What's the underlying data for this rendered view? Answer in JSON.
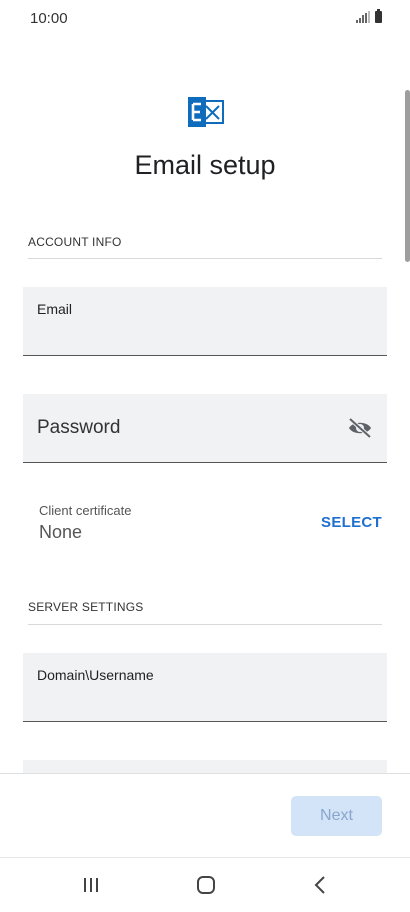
{
  "status_bar": {
    "time": "10:00"
  },
  "app": {
    "logo_icon": "exchange-logo-icon",
    "title": "Email setup"
  },
  "account_info": {
    "section_label": "ACCOUNT INFO",
    "email": {
      "label": "Email",
      "value": ""
    },
    "password": {
      "label": "Password",
      "value": "",
      "toggle_icon": "eye-off-icon"
    },
    "client_certificate": {
      "label": "Client certificate",
      "value": "None",
      "action_label": "SELECT"
    }
  },
  "server_settings": {
    "section_label": "SERVER SETTINGS",
    "domain_username": {
      "label": "Domain\\Username",
      "value": ""
    }
  },
  "footer": {
    "next_label": "Next"
  },
  "navigation": {
    "recents_icon": "recents-icon",
    "home_icon": "home-icon",
    "back_icon": "back-icon"
  },
  "colors": {
    "accent": "#1f6fd1",
    "exchange_blue": "#0f6cbd",
    "disabled_button": "#d3e3f8"
  }
}
